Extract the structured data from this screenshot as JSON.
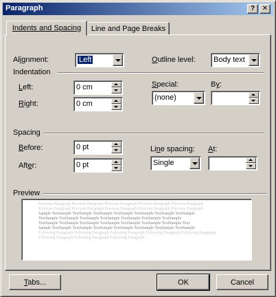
{
  "window": {
    "title": "Paragraph",
    "help_glyph": "?",
    "close_glyph": "✕"
  },
  "tabs": [
    {
      "label": "Indents and Spacing",
      "active": true
    },
    {
      "label": "Line and Page Breaks",
      "active": false
    }
  ],
  "general": {
    "alignment_label_pre": "Al",
    "alignment_label_u": "i",
    "alignment_label_post": "gnment:",
    "alignment_value": "Left",
    "outline_label_u": "O",
    "outline_label_post": "utline level:",
    "outline_value": "Body text"
  },
  "indentation": {
    "group_label": "Indentation",
    "left_label_u": "L",
    "left_label_post": "eft:",
    "left_value": "0 cm",
    "right_label_u": "R",
    "right_label_post": "ight:",
    "right_value": "0 cm",
    "special_label_u": "S",
    "special_label_post": "pecial:",
    "special_value": "(none)",
    "by_label_pre": "B",
    "by_label_u": "y",
    "by_label_post": ":",
    "by_value": ""
  },
  "spacing": {
    "group_label": "Spacing",
    "before_label_u": "B",
    "before_label_post": "efore:",
    "before_value": "0 pt",
    "after_label_pre": "Aft",
    "after_label_u": "e",
    "after_label_post": "r:",
    "after_value": "0 pt",
    "line_label_pre": "Li",
    "line_label_u": "n",
    "line_label_post": "e spacing:",
    "line_value": "Single",
    "at_label_u": "A",
    "at_label_post": "t:",
    "at_value": ""
  },
  "preview": {
    "group_label": "Preview",
    "prev_lines": [
      "Previous Paragraph Previous Paragraph Previous Paragraph Previous Paragraph Previous Paragraph",
      "Previous Paragraph Previous Paragraph Previous Paragraph Previous Paragraph Previous Paragraph"
    ],
    "sample_lines": [
      "Sample TextSample TextSample TextSample TextSample TextSample TextSample TextSample",
      "TextSample TextSample TextSample TextSample TextSample TextSample TextSample",
      "TextSample TextSample TextSample TextSample TextSample TextSample TextSample Text",
      "Sample TextSample TextSample TextSample TextSample TextSample TextSample TextSample"
    ],
    "next_lines": [
      "Following Paragraph Following Paragraph Following Paragraph Following Paragraph Following Paragraph",
      "Following Paragraph Following Paragraph Following Paragraph"
    ]
  },
  "buttons": {
    "tabs_pre": "",
    "tabs_u": "T",
    "tabs_post": "abs...",
    "ok": "OK",
    "cancel": "Cancel"
  }
}
